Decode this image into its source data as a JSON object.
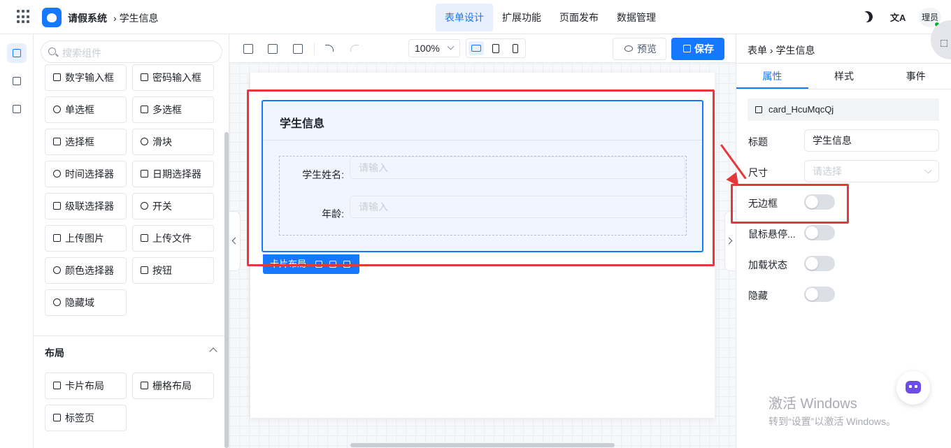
{
  "header": {
    "app_name": "请假系统",
    "breadcrumb": "学生信息",
    "tabs": [
      {
        "label": "表单设计",
        "active": true
      },
      {
        "label": "扩展功能",
        "active": false
      },
      {
        "label": "页面发布",
        "active": false
      },
      {
        "label": "数据管理",
        "active": false
      }
    ],
    "avatar_text": "理员",
    "accent_color": "#1677ff"
  },
  "components": {
    "search_placeholder": "搜索组件",
    "items": [
      {
        "label": "数字输入框",
        "icon": "number-icon"
      },
      {
        "label": "密码输入框",
        "icon": "lock-icon"
      },
      {
        "label": "单选框",
        "icon": "radio-icon"
      },
      {
        "label": "多选框",
        "icon": "checkbox-icon"
      },
      {
        "label": "选择框",
        "icon": "select-icon"
      },
      {
        "label": "滑块",
        "icon": "slider-icon"
      },
      {
        "label": "时间选择器",
        "icon": "clock-icon"
      },
      {
        "label": "日期选择器",
        "icon": "calendar-icon"
      },
      {
        "label": "级联选择器",
        "icon": "cascader-icon"
      },
      {
        "label": "开关",
        "icon": "switch-icon"
      },
      {
        "label": "上传图片",
        "icon": "image-icon"
      },
      {
        "label": "上传文件",
        "icon": "upload-icon"
      },
      {
        "label": "颜色选择器",
        "icon": "palette-icon"
      },
      {
        "label": "按钮",
        "icon": "button-icon"
      },
      {
        "label": "隐藏域",
        "icon": "eye-off-icon"
      }
    ],
    "layout_section_title": "布局",
    "layout_items": [
      {
        "label": "卡片布局",
        "icon": "card-icon"
      },
      {
        "label": "栅格布局",
        "icon": "grid-layout-icon"
      },
      {
        "label": "标签页",
        "icon": "tabs-icon"
      }
    ]
  },
  "toolbar": {
    "zoom": "100%",
    "preview_label": "预览",
    "save_label": "保存"
  },
  "canvas": {
    "card_title": "学生信息",
    "fields": [
      {
        "label": "学生姓名:",
        "placeholder": "请输入"
      },
      {
        "label": "年龄:",
        "placeholder": "请输入"
      }
    ],
    "card_tag_label": "卡片布局"
  },
  "properties": {
    "breadcrumb_root": "表单",
    "breadcrumb_current": "学生信息",
    "tabs": [
      {
        "label": "属性",
        "active": true
      },
      {
        "label": "样式",
        "active": false
      },
      {
        "label": "事件",
        "active": false
      }
    ],
    "component_id": "card_HcuMqcQj",
    "title_label": "标题",
    "title_value": "学生信息",
    "size_label": "尺寸",
    "size_placeholder": "请选择",
    "toggles": [
      {
        "label": "无边框",
        "on": false
      },
      {
        "label": "鼠标悬停...",
        "on": false
      },
      {
        "label": "加载状态",
        "on": false
      },
      {
        "label": "隐藏",
        "on": false
      }
    ]
  },
  "watermark": {
    "line1": "激活 Windows",
    "line2": "转到“设置”以激活 Windows。"
  }
}
